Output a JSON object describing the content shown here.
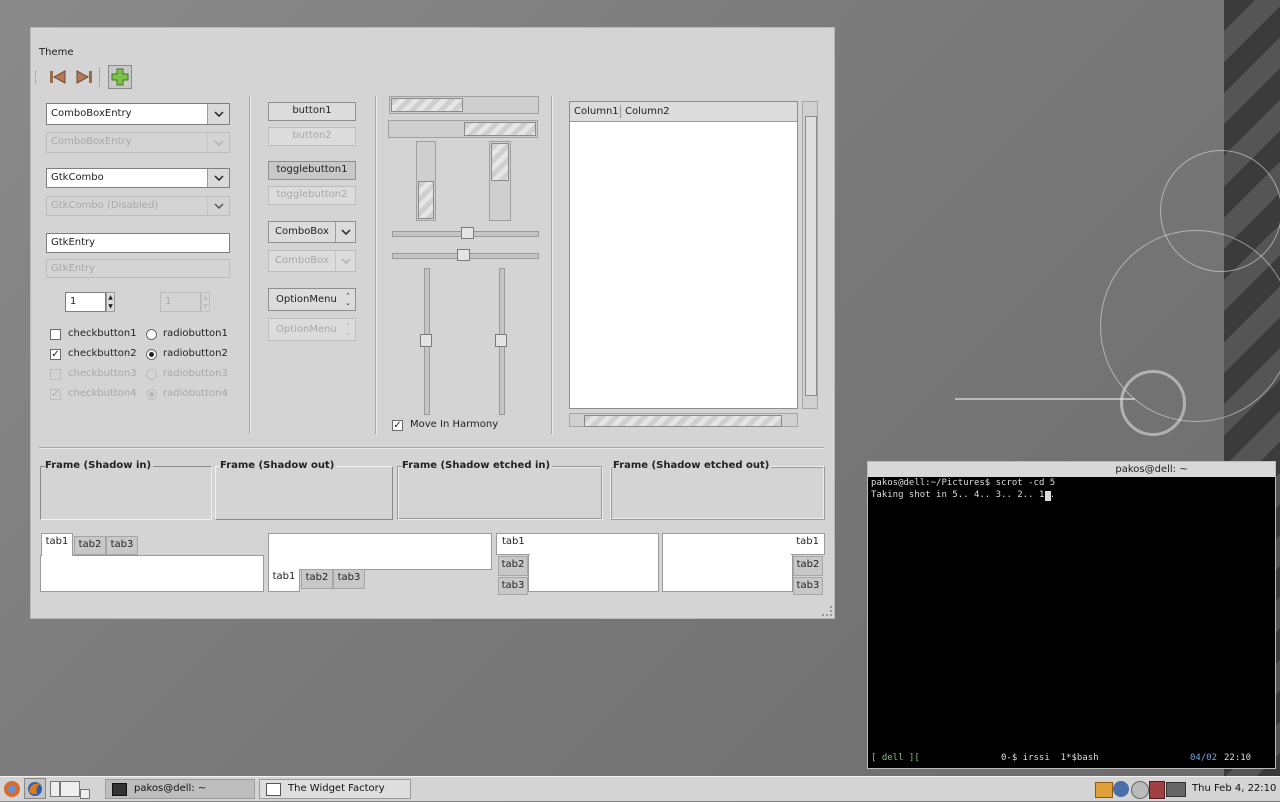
{
  "window": {
    "title": "Theme"
  },
  "left": {
    "combo_entry": "ComboBoxEntry",
    "combo_entry_disabled": "ComboBoxEntry",
    "gtk_combo": "GtkCombo",
    "gtk_combo_disabled": "GtkCombo (Disabled)",
    "gtk_entry": "GtkEntry",
    "gtk_entry_disabled": "GtkEntry",
    "spin_value": "1",
    "spin_disabled_value": "1",
    "checkbuttons": [
      "checkbutton1",
      "checkbutton2",
      "checkbutton3",
      "checkbutton4"
    ],
    "radiobuttons": [
      "radiobutton1",
      "radiobutton2",
      "radiobutton3",
      "radiobutton4"
    ]
  },
  "middle": {
    "button1": "button1",
    "button2": "button2",
    "togglebutton1": "togglebutton1",
    "togglebutton2": "togglebutton2",
    "combobox": "ComboBox",
    "combobox_disabled": "ComboBox",
    "optionmenu": "OptionMenu",
    "optionmenu_disabled": "OptionMenu"
  },
  "sliders": {
    "move_in_harmony": "Move In Harmony"
  },
  "tree": {
    "columns": [
      "Column1",
      "Column2"
    ]
  },
  "frames": [
    "Frame (Shadow in)",
    "Frame (Shadow out)",
    "Frame (Shadow etched in)",
    "Frame (Shadow etched out)"
  ],
  "tabs": [
    "tab1",
    "tab2",
    "tab3"
  ],
  "terminal": {
    "title": "pakos@dell: ~",
    "line1": "pakos@dell:~/Pictures$ scrot -cd 5",
    "line2": "Taking shot in 5.. 4.. 3.. 2.. 1.. ",
    "status_left": "[ dell ][",
    "status_mid": "0-$ irssi  1*$bash",
    "status_date": "04/02",
    "status_time": "22:10"
  },
  "taskbar": {
    "tasks": [
      "pakos@dell: ~",
      "The Widget Factory"
    ],
    "clock": "Thu Feb  4, 22:10"
  }
}
